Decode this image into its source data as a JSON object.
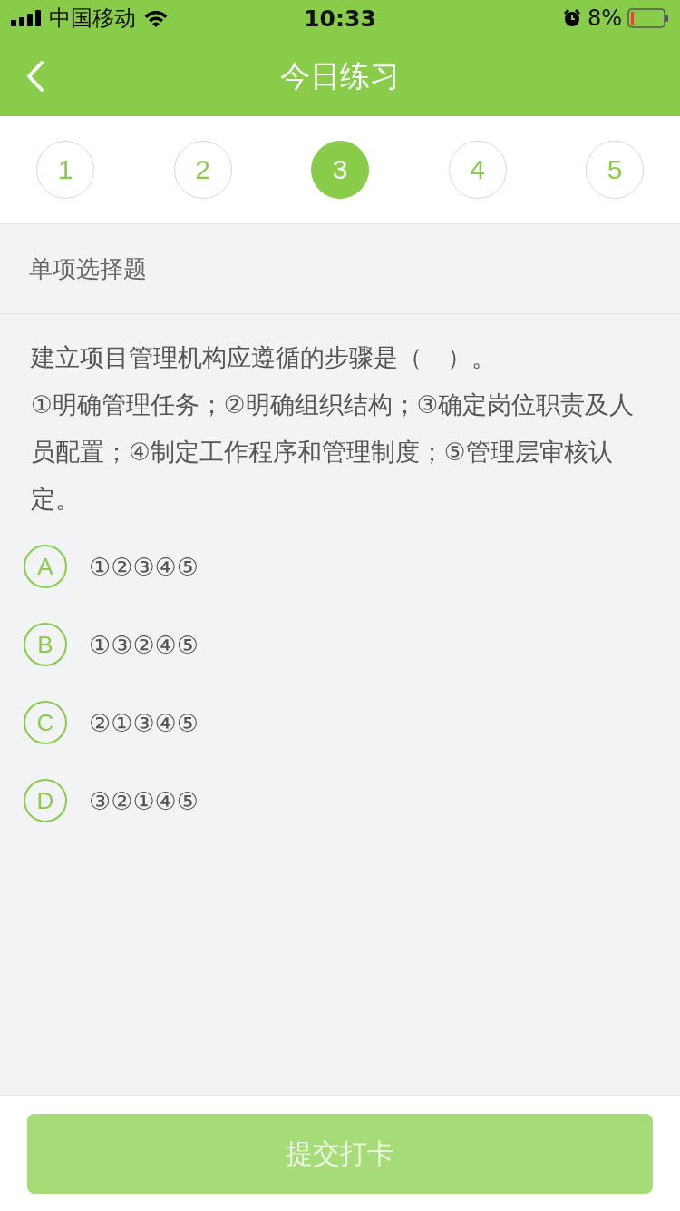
{
  "status_bar": {
    "carrier": "中国移动",
    "time": "10:33",
    "battery": "8%"
  },
  "nav": {
    "title": "今日练习"
  },
  "steps": [
    {
      "label": "1",
      "selected": false
    },
    {
      "label": "2",
      "selected": false
    },
    {
      "label": "3",
      "selected": true
    },
    {
      "label": "4",
      "selected": false
    },
    {
      "label": "5",
      "selected": false
    }
  ],
  "section": "单项选择题",
  "question": [
    "建立项目管理机构应遵循的步骤是（　）。",
    "①明确管理任务；②明确组织结构；③确定岗位职责及人员配置；④制定工作程序和管理制度；⑤管理层审核认定。"
  ],
  "options": [
    {
      "letter": "A",
      "text": "①②③④⑤",
      "selected": false
    },
    {
      "letter": "B",
      "text": "①③②④⑤",
      "selected": false
    },
    {
      "letter": "C",
      "text": "②①③④⑤",
      "selected": false
    },
    {
      "letter": "D",
      "text": "③②①④⑤",
      "selected": false
    }
  ],
  "submit": {
    "label": "提交打卡",
    "disabled": true
  }
}
